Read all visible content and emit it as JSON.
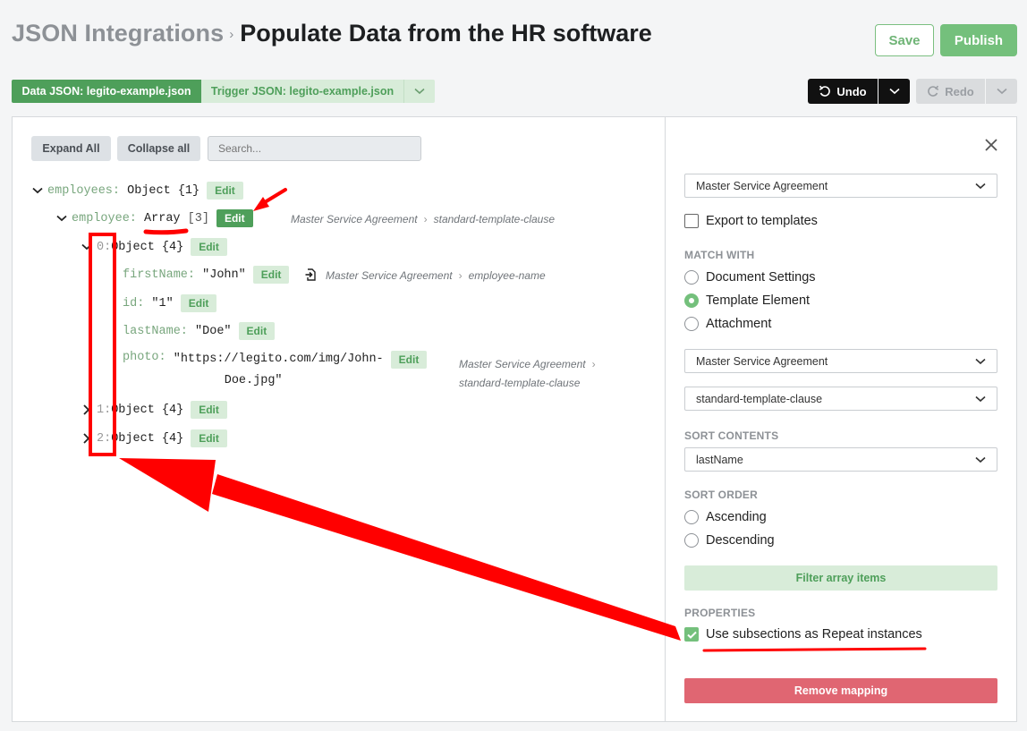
{
  "header": {
    "breadcrumb": "JSON Integrations",
    "title": "Populate Data from the HR software",
    "save_label": "Save",
    "publish_label": "Publish"
  },
  "json_tabs": {
    "data": "Data JSON: legito-example.json",
    "trigger": "Trigger JSON: legito-example.json"
  },
  "history": {
    "undo": "Undo",
    "redo": "Redo"
  },
  "toolbar": {
    "expand_all": "Expand All",
    "collapse_all": "Collapse all",
    "search_placeholder": "Search..."
  },
  "tree": {
    "employees_key": "employees:",
    "employees_val": "Object {1}",
    "employee_key": "employee:",
    "employee_type": "Array",
    "employee_count": "[3]",
    "item0_key": "0:",
    "item0_val": "Object {4}",
    "firstName_key": "firstName:",
    "firstName_val": "\"John\"",
    "id_key": "id:",
    "id_val": "\"1\"",
    "lastName_key": "lastName:",
    "lastName_val": "\"Doe\"",
    "photo_key": "photo:",
    "photo_val_1": "\"https://legito.com/img/John-",
    "photo_val_2": "Doe.jpg\"",
    "item1_key": "1:",
    "item1_val": "Object {4}",
    "item2_key": "2:",
    "item2_val": "Object {4}",
    "edit_label": "Edit"
  },
  "mappings": {
    "employee_doc": "Master Service Agreement",
    "employee_el": "standard-template-clause",
    "firstName_doc": "Master Service Agreement",
    "firstName_el": "employee-name",
    "photo_doc": "Master Service Agreement",
    "photo_el": "standard-template-clause"
  },
  "side": {
    "template_select": "Master Service Agreement",
    "export_label": "Export to templates",
    "match_with_label": "MATCH WITH",
    "match_options": [
      "Document Settings",
      "Template Element",
      "Attachment"
    ],
    "match_selected": "Template Element",
    "doc_select": "Master Service Agreement",
    "element_select": "standard-template-clause",
    "sort_contents_label": "SORT CONTENTS",
    "sort_contents_value": "lastName",
    "sort_order_label": "SORT ORDER",
    "sort_order_options": [
      "Ascending",
      "Descending"
    ],
    "filter_label": "Filter array items",
    "properties_label": "PROPERTIES",
    "repeat_label": "Use subsections as Repeat instances",
    "repeat_checked": true,
    "remove_label": "Remove mapping"
  },
  "colors": {
    "accent_green": "#4e9f5a",
    "light_green": "#d8ecd9",
    "danger": "#e06672",
    "annotation_red": "#ff0000"
  }
}
